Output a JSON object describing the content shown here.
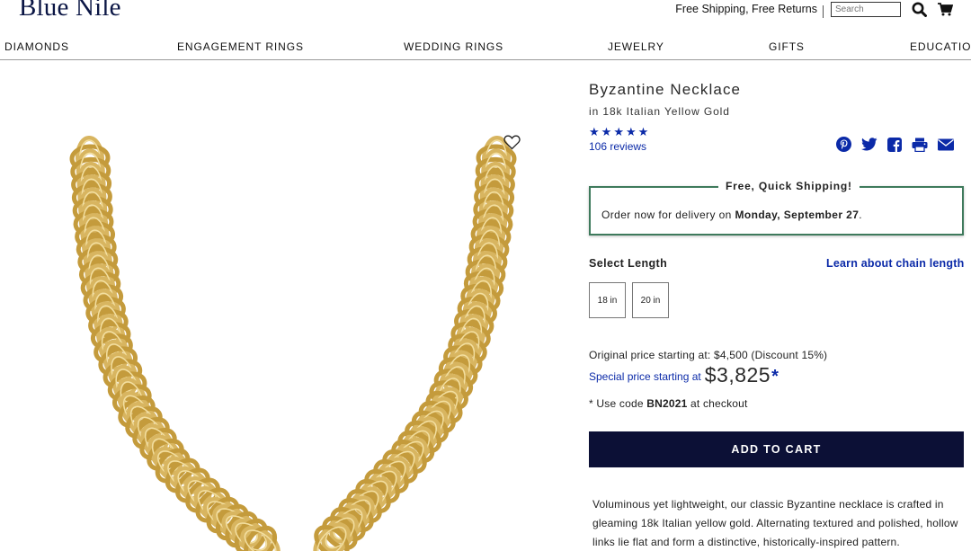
{
  "header": {
    "logo_text": "Blue Nile",
    "shipping_text": "Free Shipping, Free Returns",
    "search_placeholder": "Search",
    "icons": [
      "search-icon",
      "cart-icon"
    ]
  },
  "nav": {
    "items": [
      "DIAMONDS",
      "ENGAGEMENT RINGS",
      "WEDDING RINGS",
      "JEWELRY",
      "GIFTS",
      "EDUCATION"
    ]
  },
  "product": {
    "title": "Byzantine Necklace",
    "subtitle": "in 18k Italian Yellow Gold",
    "rating_stars": 5,
    "reviews": "106 reviews",
    "share_icons": [
      "pinterest-icon",
      "twitter-icon",
      "facebook-icon",
      "print-icon",
      "email-icon"
    ],
    "wishlist_icon": "heart-icon"
  },
  "shipping_box": {
    "heading": "Free, Quick Shipping!",
    "text_prefix": "Order now for delivery on ",
    "date": "Monday, September 27",
    "text_suffix": "."
  },
  "length": {
    "label": "Select Length",
    "link": "Learn about chain length",
    "options": [
      "18 in",
      "20 in"
    ]
  },
  "pricing": {
    "original": "Original price starting at: $4,500 (Discount 15%)",
    "special_label": "Special price starting at",
    "special_price": "$3,825",
    "asterisk": "*",
    "code_prefix": "* Use code ",
    "code": "BN2021",
    "code_suffix": " at checkout"
  },
  "cart": {
    "label": "ADD TO CART"
  },
  "description": {
    "text": "Voluminous yet lightweight, our classic Byzantine necklace is crafted in gleaming 18k Italian yellow gold. Alternating textured and polished, hollow links lie flat and form a distinctive, historically-inspired pattern."
  },
  "colors": {
    "brand_navy": "#0c1036",
    "link_blue": "#0b2aa8",
    "ship_green": "#3e7a5c",
    "gold": "#d8b560"
  }
}
